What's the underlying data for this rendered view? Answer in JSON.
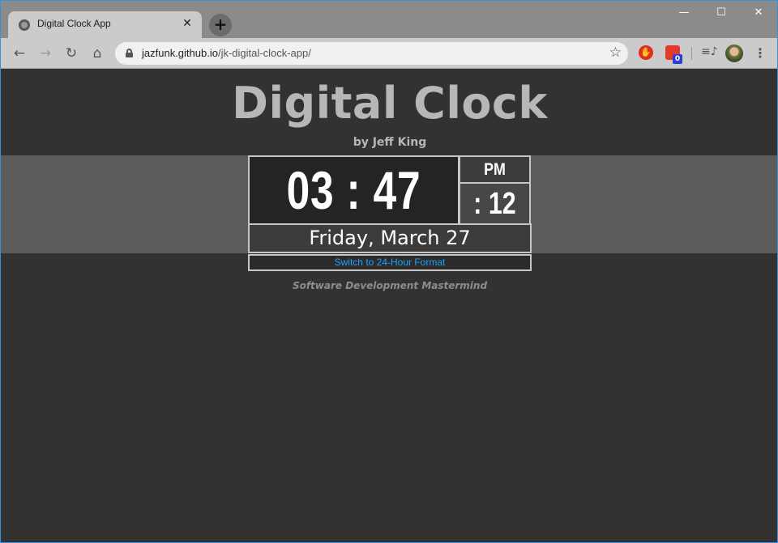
{
  "browser": {
    "tab_title": "Digital Clock App",
    "tab_close": "✕",
    "new_tab": "+",
    "url_host": "jazfunk.github.io",
    "url_path": "/jk-digital-clock-app/",
    "extension_badge": "0",
    "window_controls": {
      "minimize": "—",
      "maximize": "☐",
      "close": "✕"
    },
    "nav": {
      "back": "←",
      "forward": "→",
      "reload": "↻",
      "home": "⌂"
    }
  },
  "app": {
    "title": "Digital Clock",
    "author": "by Jeff King",
    "time": "03 : 47",
    "ampm": "PM",
    "seconds": ": 12",
    "date": "Friday, March 27",
    "format_button": "Switch to 24-Hour Format",
    "tagline": "Software Development Mastermind"
  },
  "colors": {
    "page_bg": "#343230",
    "band_bg": "#5c5c5a",
    "title": "#b7b7b7",
    "link": "#1aa3ff"
  }
}
